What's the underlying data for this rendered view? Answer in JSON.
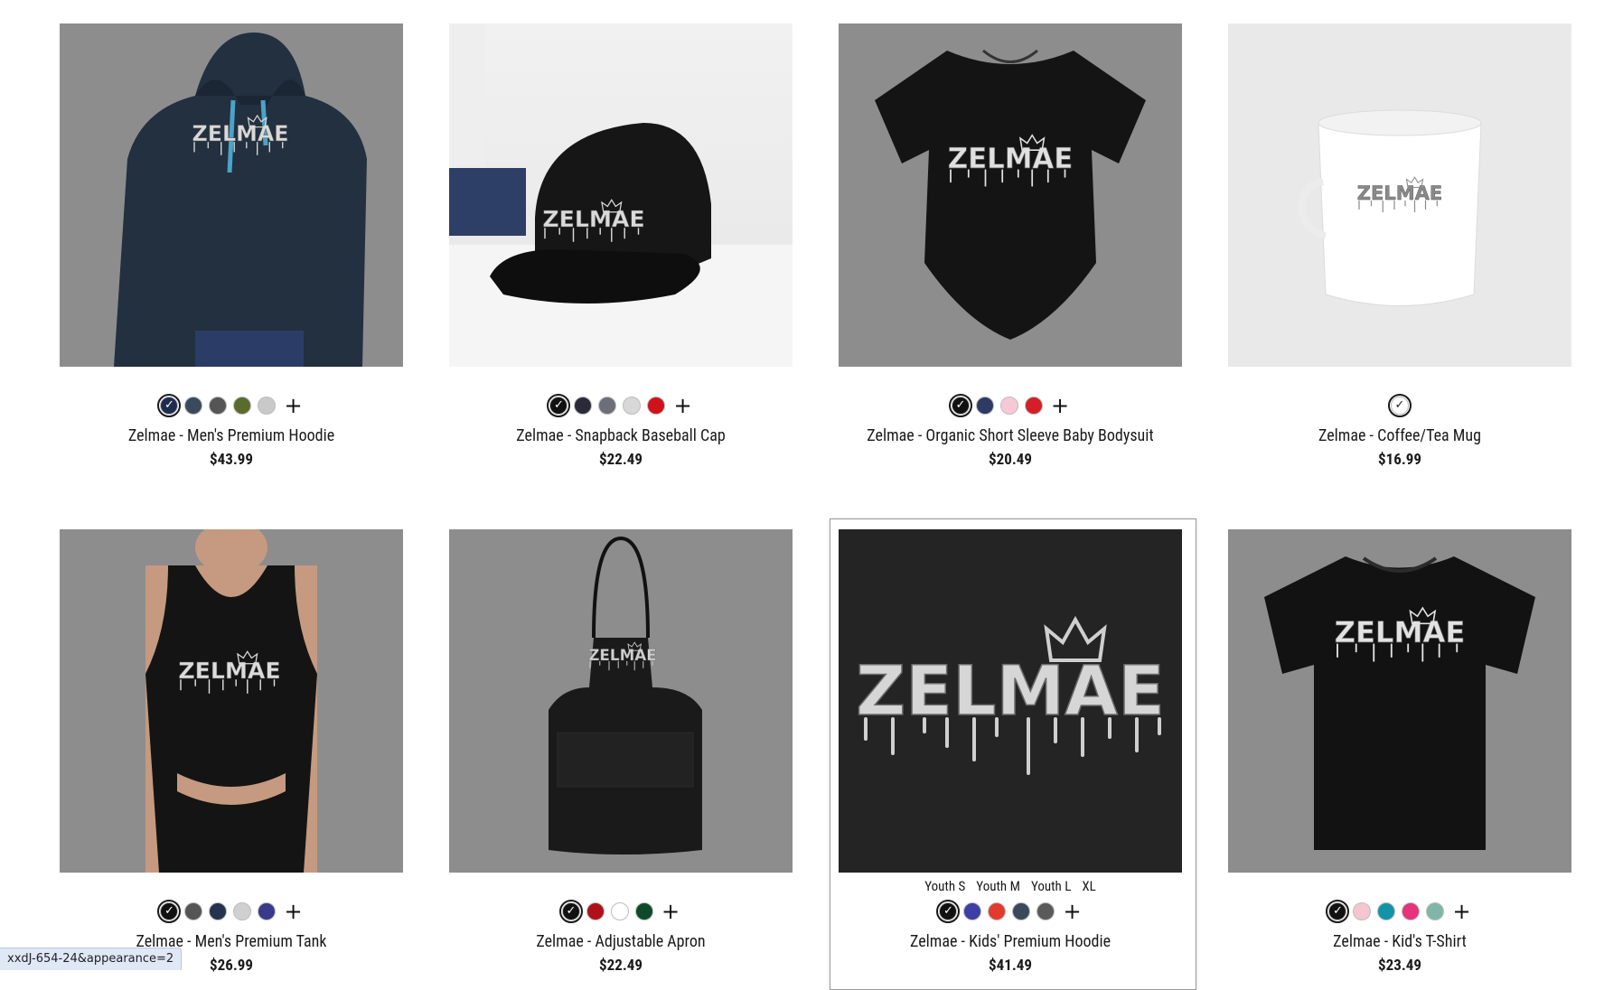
{
  "products": [
    {
      "title": "Zelmae - Men's Premium Hoodie",
      "price": "$43.99",
      "thumb_style": "grey",
      "item": "hoodie",
      "colors": [
        "#1c2d4f",
        "#3a4a5c",
        "#555555",
        "#5a6b2e",
        "#c9c9c9"
      ],
      "selected": 0,
      "more": "+"
    },
    {
      "title": "Zelmae - Snapback Baseball Cap",
      "price": "$22.49",
      "thumb_style": "room",
      "item": "cap",
      "colors": [
        "#111111",
        "#2a2a3a",
        "#6e6e78",
        "#d8d8d8",
        "#d0121b"
      ],
      "selected": 0,
      "more": "+"
    },
    {
      "title": "Zelmae - Organic Short Sleeve Baby Bodysuit",
      "price": "$20.49",
      "thumb_style": "grey",
      "item": "bodysuit",
      "colors": [
        "#111111",
        "#2d3a66",
        "#f7c9d6",
        "#d41f26"
      ],
      "selected": 0,
      "more": "+"
    },
    {
      "title": "Zelmae - Coffee/Tea Mug",
      "price": "$16.99",
      "thumb_style": "light",
      "item": "mug",
      "colors": [
        "#ffffff"
      ],
      "selected": 0,
      "more": ""
    },
    {
      "title": "Zelmae - Men's Premium Tank",
      "price": "$26.99",
      "thumb_style": "grey",
      "item": "tank",
      "colors": [
        "#111111",
        "#555555",
        "#24344f",
        "#d0d0d0",
        "#3a3a8c"
      ],
      "selected": 0,
      "more": "+"
    },
    {
      "title": "Zelmae - Adjustable Apron",
      "price": "$22.49",
      "thumb_style": "grey",
      "item": "apron",
      "colors": [
        "#111111",
        "#b0101c",
        "#ffffff",
        "#0e4a2a"
      ],
      "selected": 0,
      "more": "+"
    },
    {
      "title": "Zelmae - Kids' Premium Hoodie",
      "price": "$41.49",
      "thumb_style": "dark",
      "item": "closeup",
      "sizes": [
        "Youth S",
        "Youth M",
        "Youth L",
        "XL"
      ],
      "colors": [
        "#111111",
        "#3d3fa6",
        "#e23b2e",
        "#3a4a5c",
        "#5a5a5a"
      ],
      "selected": 0,
      "more": "+"
    },
    {
      "title": "Zelmae - Kid's T-Shirt",
      "price": "$23.49",
      "thumb_style": "grey",
      "item": "tshirt",
      "colors": [
        "#111111",
        "#f5c6d1",
        "#1293a8",
        "#e5337c",
        "#7fb6a8"
      ],
      "selected": 0,
      "more": "+"
    }
  ],
  "logo_text": "ZELMAE",
  "status_url": "xxdJ-654-24&appearance=2"
}
